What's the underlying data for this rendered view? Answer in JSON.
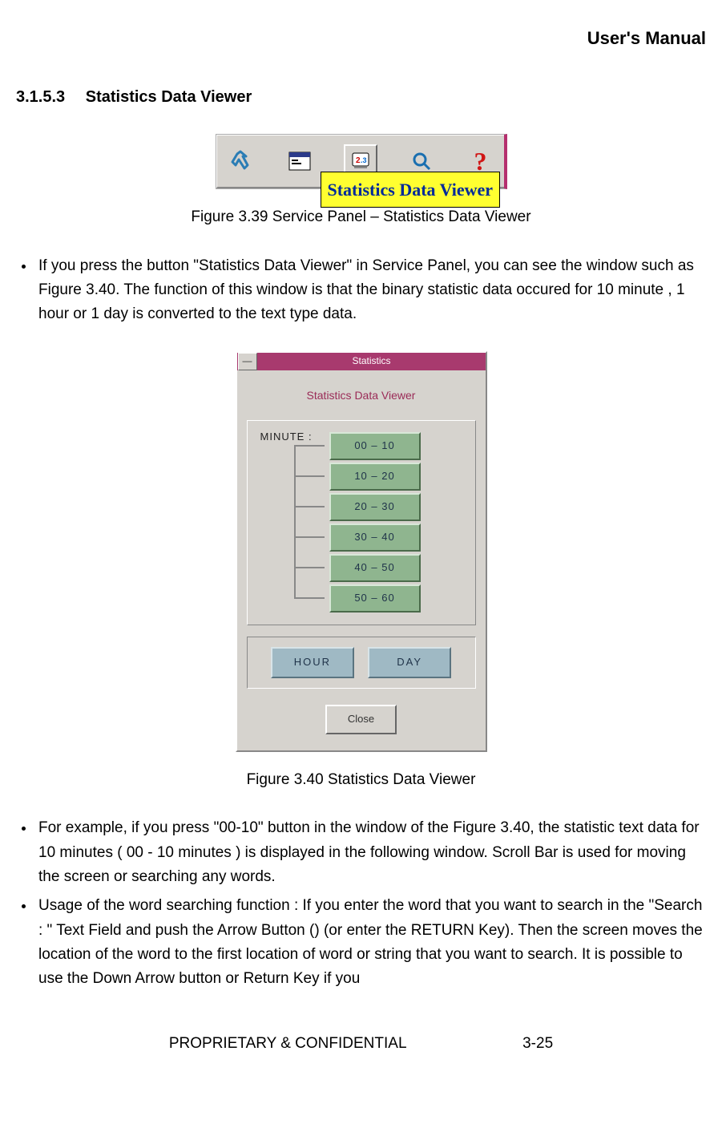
{
  "header": {
    "doc_title": "User's Manual"
  },
  "section": {
    "number": "3.1.5.3",
    "title": "Statistics Data Viewer"
  },
  "toolbar": {
    "tooltip": "Statistics Data Viewer"
  },
  "caption1": "Figure 3.39 Service Panel – Statistics Data Viewer",
  "bullets_top": [
    "If you press the button \"Statistics Data Viewer\" in Service Panel, you can see the window such as Figure 3.40. The function of this window is that the binary statistic data occured for 10 minute , 1 hour or 1 day is converted to the text type data."
  ],
  "stats_window": {
    "title": "Statistics",
    "panel_title": "Statistics Data Viewer",
    "minute_label": "MINUTE :",
    "minute_buttons": [
      "00 – 10",
      "10 – 20",
      "20 – 30",
      "30 – 40",
      "40 – 50",
      "50 – 60"
    ],
    "hour_label": "HOUR",
    "day_label": "DAY",
    "close_label": "Close"
  },
  "caption2": "Figure 3.40 Statistics Data Viewer",
  "bullets_bottom": [
    "For example, if you press \"00-10\" button in the window of the Figure 3.40, the statistic text data for 10 minutes ( 00 - 10 minutes ) is displayed in the following window. Scroll Bar is used for moving the screen or searching any words.",
    "Usage of the word searching function : If you enter the word that you want to search in the \"Search : \" Text Field and push the Arrow Button () (or enter the RETURN Key). Then the screen moves the location of the word to the first location of word or string that you want to search. It is possible to use the Down Arrow button or Return Key if you"
  ],
  "footer": {
    "classification": "PROPRIETARY & CONFIDENTIAL",
    "page": "3-25"
  }
}
